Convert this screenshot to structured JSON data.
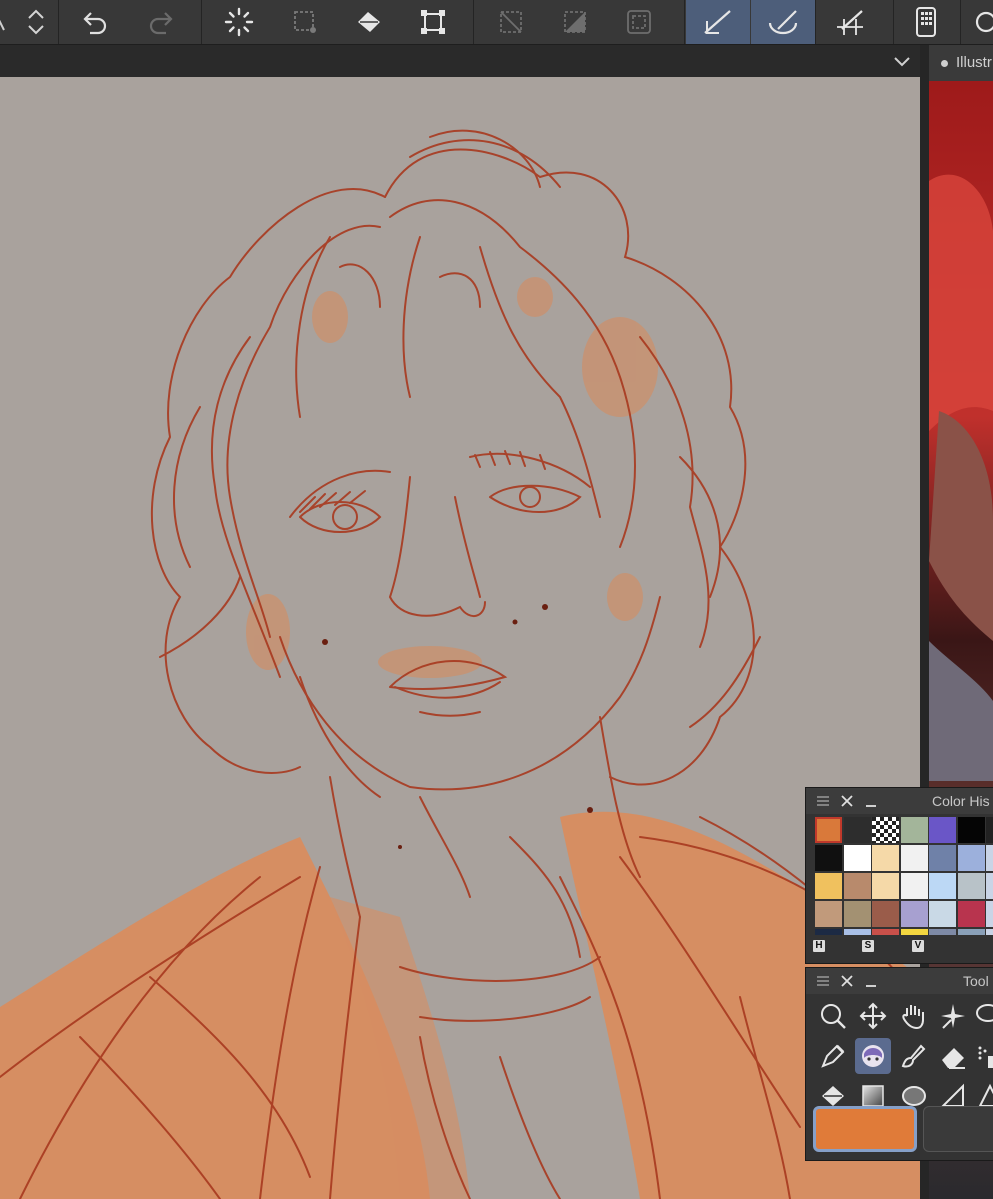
{
  "toolbar": {
    "tools": [
      {
        "name": "scroll-updown",
        "icon": "chevron-up-down-icon"
      },
      {
        "name": "undo",
        "icon": "undo-icon"
      },
      {
        "name": "redo",
        "icon": "redo-icon"
      },
      {
        "name": "loading",
        "icon": "spinner-icon"
      },
      {
        "name": "select-all",
        "icon": "dashed-select-icon"
      },
      {
        "name": "fill",
        "icon": "paint-bucket-icon"
      },
      {
        "name": "transform",
        "icon": "transform-icon"
      },
      {
        "name": "clear-selection",
        "icon": "clear-selection-icon"
      },
      {
        "name": "invert-selection",
        "icon": "invert-selection-icon"
      },
      {
        "name": "show-selection",
        "icon": "selection-frame-icon"
      },
      {
        "name": "ruler-snap",
        "icon": "ruler-snap-icon",
        "active": true
      },
      {
        "name": "special-ruler-snap",
        "icon": "curve-ruler-icon",
        "active": true
      },
      {
        "name": "grid-snap",
        "icon": "grid-snap-icon"
      },
      {
        "name": "smartphone",
        "icon": "phone-icon"
      }
    ]
  },
  "reference": {
    "tab_label": "Illustr"
  },
  "color_history": {
    "title": "Color His",
    "swatches": [
      [
        "#d9793a",
        "#2d2d2d",
        "transparent",
        "#a3b59a",
        "#6a56c7",
        "#050505",
        "#222"
      ],
      [
        "#101010",
        "#ffffff",
        "#f5d9a8",
        "#f1f1f1",
        "#6f81a8",
        "#9cb0dc",
        "#c9d4e6"
      ],
      [
        "#f0c15e",
        "#b88a6c",
        "#f5d9a8",
        "#f1f1f1",
        "#bcd8f5",
        "#b8c2c8",
        "#c9d4e6"
      ],
      [
        "#c19a7b",
        "#a39172",
        "#9a5c4a",
        "#a7a0d0",
        "#c9d9e6",
        "#b8344e",
        "#c9d4e6"
      ]
    ],
    "hsv_labels": [
      "H",
      "S",
      "V"
    ]
  },
  "tool_palette": {
    "title": "Tool",
    "rows": [
      [
        "magnifier-icon",
        "move-icon",
        "hand-icon",
        "auto-select-icon",
        "lasso-icon"
      ],
      [
        "pen-icon",
        "avatar-brush-icon",
        "brush-icon",
        "eraser-icon",
        "spray-icon"
      ],
      [
        "fill-icon",
        "gradient-icon",
        "blob-icon",
        "figure-icon",
        "ruler-icon"
      ]
    ]
  },
  "colors": {
    "main": "#e07b39",
    "canvas_bg": "#a9a29d",
    "line": "#a8391f",
    "fill": "#df8a55",
    "active_tool_bg": "#4d5e7a"
  }
}
